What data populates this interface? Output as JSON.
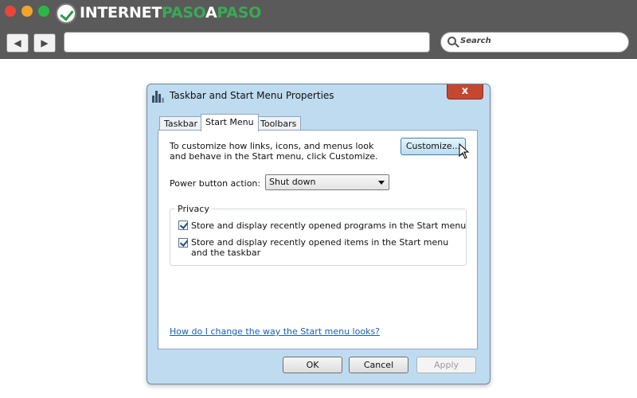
{
  "browser": {
    "brand_part1": "INTERNET",
    "brand_part2": "PASO",
    "brand_part3": "A",
    "brand_part4": "PASO",
    "search_placeholder": "Search",
    "back_icon": "◀",
    "forward_icon": "▶"
  },
  "dialog": {
    "title": "Taskbar and Start Menu Properties",
    "close_label": "x",
    "tabs": [
      {
        "label": "Taskbar",
        "selected": false
      },
      {
        "label": "Start Menu",
        "selected": true
      },
      {
        "label": "Toolbars",
        "selected": false
      }
    ],
    "intro_text": "To customize how links, icons, and menus look and behave in the Start menu, click Customize.",
    "customize_label": "Customize...",
    "power_button_label": "Power button action:",
    "power_button_value": "Shut down",
    "privacy_legend": "Privacy",
    "privacy_options": [
      {
        "label": "Store and display recently opened programs in the Start menu",
        "checked": true
      },
      {
        "label": "Store and display recently opened items in the Start menu and the taskbar",
        "checked": true
      }
    ],
    "help_link": "How do I change the way the Start menu looks?",
    "buttons": {
      "ok": "OK",
      "cancel": "Cancel",
      "apply": "Apply"
    }
  },
  "colors": {
    "chrome": "#5a5a5a",
    "brand_green": "#3aa957",
    "dialog_frame": "#bfdbf0",
    "close_red": "#c6472f",
    "link_blue": "#1a5cb8"
  }
}
